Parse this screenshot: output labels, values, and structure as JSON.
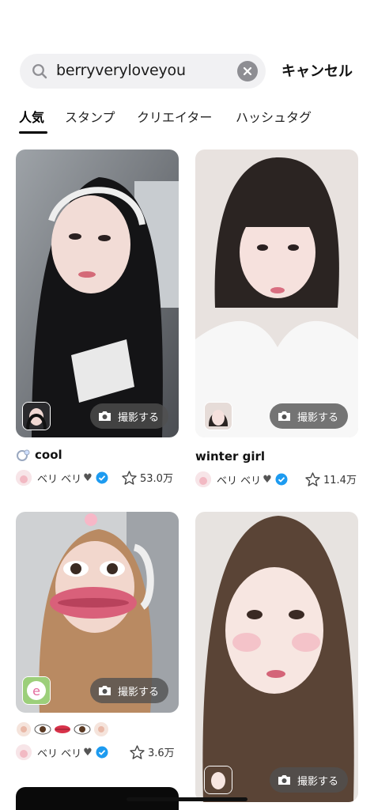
{
  "search": {
    "query": "berryveryloveyou",
    "cancel_label": "キャンセル"
  },
  "tabs": [
    {
      "label": "人気",
      "active": true
    },
    {
      "label": "スタンプ",
      "active": false
    },
    {
      "label": "クリエイター",
      "active": false
    },
    {
      "label": "ハッシュタグ",
      "active": false
    }
  ],
  "cards": [
    {
      "title": "cool",
      "title_prefix_icon": "ring-icon",
      "author": "ベリ ベリ",
      "author_heart": "♥",
      "favorites": "53.0万",
      "shoot_label": "撮影する"
    },
    {
      "title": "winter girl",
      "author": "ベリ ベリ",
      "author_heart": "♥",
      "favorites": "11.4万",
      "shoot_label": "撮影する"
    },
    {
      "title": "",
      "title_emojis": [
        "face-icon",
        "eye-icon",
        "lips-icon",
        "eye-icon",
        "face-icon"
      ],
      "author": "ベリ ベリ",
      "author_heart": "♥",
      "favorites": "3.6万",
      "shoot_label": "撮影する"
    },
    {
      "title": "",
      "shoot_label": "撮影する"
    }
  ],
  "colors": {
    "accent_verified": "#1d9bf0",
    "shoot_bg": "#505050",
    "search_bg": "#f1f1f3"
  }
}
